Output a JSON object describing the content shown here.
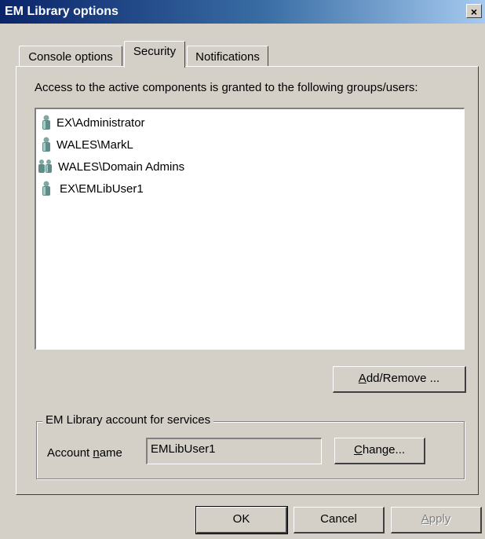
{
  "window": {
    "title": "EM Library options",
    "close_glyph": "×"
  },
  "tabs": [
    {
      "label": "Console options",
      "active": false
    },
    {
      "label": "Security",
      "active": true
    },
    {
      "label": "Notifications",
      "active": false
    }
  ],
  "security": {
    "prompt": "Access to the active components is granted to the following groups/users:",
    "principals": [
      {
        "name": "EX\\Administrator",
        "icon": "user-icon"
      },
      {
        "name": "WALES\\MarkL",
        "icon": "user-icon"
      },
      {
        "name": "WALES\\Domain Admins",
        "icon": "group-icon"
      },
      {
        "name": "EX\\EMLibUser1",
        "icon": "user-icon"
      }
    ],
    "add_remove_pre": "",
    "add_remove_key": "A",
    "add_remove_post": "dd/Remove ...",
    "account_group_label": "EM Library account for services",
    "account_label_pre": "Account ",
    "account_label_key": "n",
    "account_label_post": "ame",
    "account_value": "EMLibUser1",
    "change_key": "C",
    "change_post": "hange..."
  },
  "footer": {
    "ok_label": "OK",
    "cancel_label": "Cancel",
    "apply_key": "A",
    "apply_post": "pply"
  },
  "colors": {
    "titlebar_start": "#0a246a",
    "titlebar_end": "#a6caf0",
    "face": "#d4d0c8",
    "user_icon": "#7fa7a4"
  }
}
